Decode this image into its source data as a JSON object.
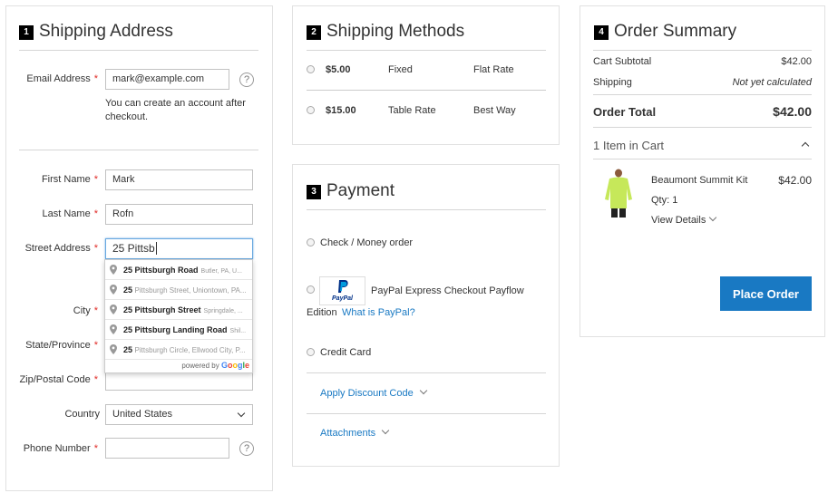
{
  "shipping_address": {
    "step": "1",
    "title": "Shipping Address",
    "email_label": "Email Address",
    "email_value": "mark@example.com",
    "email_note_line1": "You can create an account after",
    "email_note_line2": "checkout.",
    "first_name_label": "First Name",
    "first_name_value": "Mark",
    "last_name_label": "Last Name",
    "last_name_value": "Rofn",
    "street_label": "Street Address",
    "street_value": "25 Pittsb",
    "city_label": "City",
    "state_label": "State/Province",
    "zip_label": "Zip/Postal Code",
    "country_label": "Country",
    "country_value": "United States",
    "phone_label": "Phone Number",
    "required_mark": "*",
    "help_glyph": "?"
  },
  "autocomplete": {
    "items": [
      {
        "prefix": "25",
        "bold": "Pittsburgh Road",
        "sub": "Butler, PA, U..."
      },
      {
        "prefix": "25",
        "bold": "Pittsb",
        "rest": "urgh Street, Uniontown, PA...",
        "sub": ""
      },
      {
        "prefix": "25",
        "bold": "Pittsburgh Street",
        "sub": "Springdale, ..."
      },
      {
        "prefix": "25",
        "bold": "Pittsburg Landing Road",
        "sub": "Shil..."
      },
      {
        "prefix": "25",
        "bold": "Pittsb",
        "rest": "urgh Circle, Ellwood City, P...",
        "sub": ""
      }
    ],
    "powered_by": "powered by",
    "google": [
      "G",
      "o",
      "o",
      "g",
      "l",
      "e"
    ]
  },
  "shipping_methods": {
    "step": "2",
    "title": "Shipping Methods",
    "rows": [
      {
        "price": "$5.00",
        "method": "Fixed",
        "carrier": "Flat Rate"
      },
      {
        "price": "$15.00",
        "method": "Table Rate",
        "carrier": "Best Way"
      }
    ]
  },
  "payment": {
    "step": "3",
    "title": "Payment",
    "check_label": "Check / Money order",
    "paypal_logo": "PayPal",
    "paypal_label": "PayPal Express Checkout Payflow",
    "paypal_label_2": "Edition",
    "paypal_link": "What is PayPal?",
    "credit_label": "Credit Card",
    "discount_label": "Apply Discount Code",
    "attachments_label": "Attachments"
  },
  "order_summary": {
    "step": "4",
    "title": "Order Summary",
    "subtotal_label": "Cart Subtotal",
    "subtotal_value": "$42.00",
    "shipping_label": "Shipping",
    "shipping_value": "Not yet calculated",
    "total_label": "Order Total",
    "total_value": "$42.00",
    "items_in_cart": "1 Item in Cart",
    "item_name": "Beaumont Summit Kit",
    "item_price": "$42.00",
    "item_qty": "Qty: 1",
    "view_details": "View Details",
    "place_order": "Place Order"
  },
  "colors": {
    "accent": "#1979c3",
    "required": "#e02b27",
    "jacket": "#c6e85a"
  }
}
